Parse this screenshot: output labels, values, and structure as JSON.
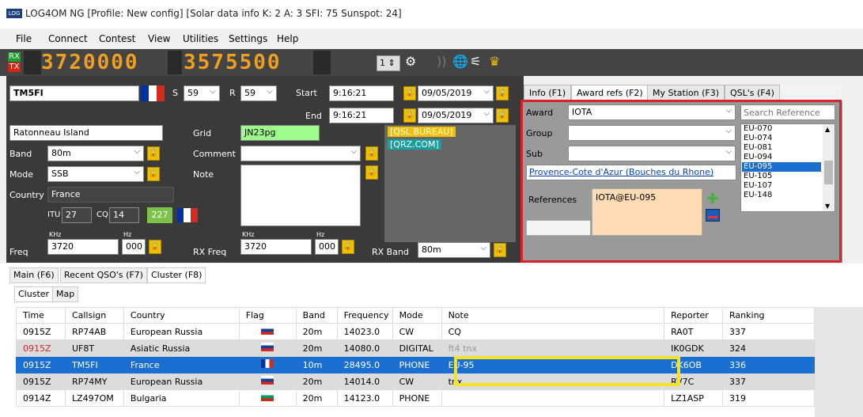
{
  "title": "LOG4OM NG [Profile: New config] [Solar data info K: 2 A: 3 SFI: 75 Sunspot: 24]",
  "logo": "LOG",
  "menu": [
    "File",
    "Connect",
    "Contest",
    "View",
    "Utilities",
    "Settings",
    "Help"
  ],
  "radio": {
    "rx": "RX",
    "tx": "TX",
    "freq1": "3720000",
    "freq2": "3575500",
    "spin": "1"
  },
  "qso": {
    "callsign": "TM5FI",
    "s_label": "S",
    "s_val": "59",
    "r_label": "R",
    "r_val": "59",
    "start_label": "Start",
    "start_time": "9:16:21",
    "start_date": "09/05/2019",
    "end_label": "End",
    "end_time": "9:16:21",
    "end_date": "09/05/2019",
    "name": "Ratonneau Island",
    "grid_label": "Grid",
    "grid": "JN23pg",
    "band_label": "Band",
    "band": "80m",
    "comment_label": "Comment",
    "mode_label": "Mode",
    "mode": "SSB",
    "note_label": "Note",
    "country_label": "Country",
    "country": "France",
    "itu_label": "ITU",
    "itu": "27",
    "cq_label": "CQ",
    "cq": "14",
    "dxcc": "227",
    "qsl1": "[QSL BUREAU]",
    "qsl2": "[QRZ.COM]",
    "khz": "KHz",
    "hz": "Hz",
    "freq_label": "Freq",
    "freq": "3720",
    "freq_hz": "000",
    "rxfreq_label": "RX Freq",
    "rxfreq": "3720",
    "rxfreq_hz": "000",
    "rxband_label": "RX Band",
    "rxband": "80m"
  },
  "tabs": [
    "Info (F1)",
    "Award refs (F2)",
    "My Station (F3)",
    "QSL's (F4)"
  ],
  "award": {
    "award_label": "Award",
    "award": "IOTA",
    "search_placeholder": "Search Reference",
    "group_label": "Group",
    "sub_label": "Sub",
    "link": "Provence-Cote d'Azur (Bouches du Rhone)",
    "refs_label": "References",
    "refs": "IOTA@EU-095",
    "list": [
      "EU-070",
      "EU-074",
      "EU-081",
      "EU-094",
      "EU-095",
      "EU-105",
      "EU-107",
      "EU-148"
    ],
    "selected": "EU-095"
  },
  "bottom_tabs": [
    "Main (F6)",
    "Recent QSO's (F7)",
    "Cluster (F8)"
  ],
  "sub_tabs": [
    "Cluster",
    "Map"
  ],
  "columns": [
    "Time",
    "Callsign",
    "Country",
    "Flag",
    "Band",
    "Frequency",
    "Mode",
    "Note",
    "Reporter",
    "Ranking"
  ],
  "rows": [
    {
      "time": "0915Z",
      "call": "RP74AB",
      "country": "European Russia",
      "flag": "ru",
      "band": "20m",
      "freq": "14023.0",
      "mode": "CW",
      "note": "CQ",
      "reporter": "RA0T",
      "rank": "337"
    },
    {
      "time": "0915Z",
      "call": "UF8T",
      "country": "Asiatic Russia",
      "flag": "ru",
      "band": "20m",
      "freq": "14080.0",
      "mode": "DIGITAL",
      "note": "ft4 tnx",
      "reporter": "IK0GDK",
      "rank": "324"
    },
    {
      "time": "0915Z",
      "call": "TM5FI",
      "country": "France",
      "flag": "fr",
      "band": "10m",
      "freq": "28495.0",
      "mode": "PHONE",
      "note": "EU-95",
      "reporter": "DK6OB",
      "rank": "336"
    },
    {
      "time": "0915Z",
      "call": "RP74MY",
      "country": "European Russia",
      "flag": "ru",
      "band": "20m",
      "freq": "14014.0",
      "mode": "CW",
      "note": "tnx",
      "reporter": "RV7C",
      "rank": "337"
    },
    {
      "time": "0914Z",
      "call": "LZ497OM",
      "country": "Bulgaria",
      "flag": "bg",
      "band": "20m",
      "freq": "14123.0",
      "mode": "PHONE",
      "note": "",
      "reporter": "LZ1ASP",
      "rank": "319"
    }
  ],
  "colors": {
    "red_highlight": "#d8232a",
    "yellow_highlight": "#f5e32a",
    "selected_row": "#1a6fd0",
    "digits": "#f0a020"
  }
}
